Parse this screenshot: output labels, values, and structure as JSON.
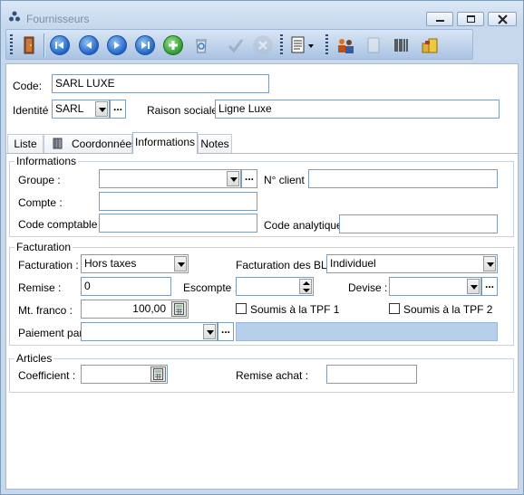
{
  "window": {
    "title": "Fournisseurs"
  },
  "header": {
    "code_label": "Code:",
    "code_value": "SARL LUXE",
    "identite_label": "Identité :",
    "identite_value": "SARL",
    "raison_label": "Raison sociale :",
    "raison_value": "Ligne Luxe"
  },
  "tabs": [
    {
      "label": "Liste"
    },
    {
      "label": "Coordonnées"
    },
    {
      "label": "Informations"
    },
    {
      "label": "Notes"
    }
  ],
  "informations": {
    "title": "Informations",
    "groupe_label": "Groupe :",
    "groupe_value": "",
    "nclient_label": "N° client :",
    "nclient_value": "",
    "compte_label": "Compte :",
    "compte_value": "",
    "code_comptable_label": "Code comptable :",
    "code_comptable_value": "",
    "code_analytique_label": "Code analytique :",
    "code_analytique_value": ""
  },
  "facturation": {
    "title": "Facturation",
    "facturation_label": "Facturation :",
    "facturation_value": "Hors taxes",
    "facturation_bl_label": "Facturation des BL :",
    "facturation_bl_value": "Individuel",
    "remise_label": "Remise :",
    "remise_value": "0",
    "escompte_label": "Escompte :",
    "escompte_value": "",
    "devise_label": "Devise :",
    "devise_value": "",
    "mt_franco_label": "Mt. franco :",
    "mt_franco_value": "100,00",
    "tpf1_label": "Soumis à la TPF 1",
    "tpf2_label": "Soumis à la TPF 2",
    "paiement_label": "Paiement par :",
    "paiement_value": ""
  },
  "articles": {
    "title": "Articles",
    "coefficient_label": "Coefficient :",
    "coefficient_value": "",
    "remise_achat_label": "Remise achat :",
    "remise_achat_value": ""
  }
}
